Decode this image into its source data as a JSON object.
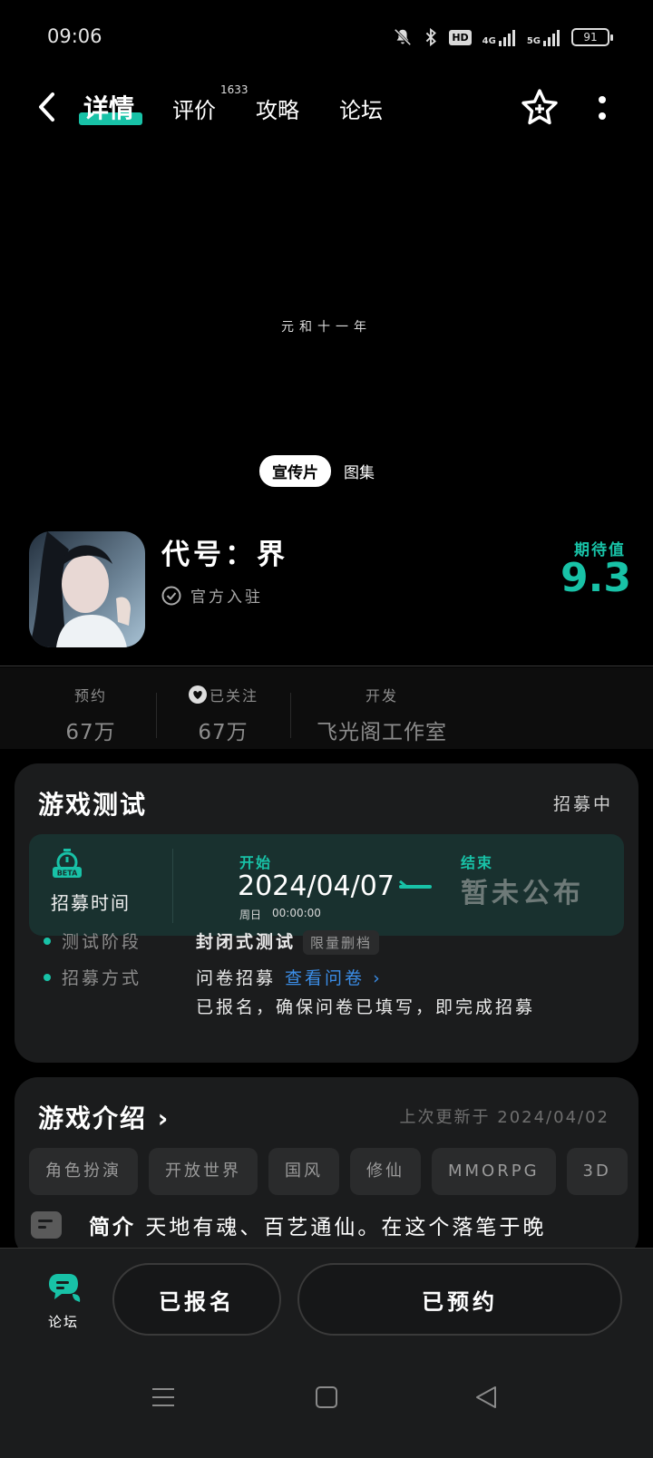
{
  "status_bar": {
    "time": "09:06",
    "network": "4G",
    "network2": "5G",
    "hd": "HD",
    "battery": "91"
  },
  "nav": {
    "tabs": [
      "详情",
      "评价",
      "攻略",
      "论坛"
    ],
    "review_count": "1633",
    "accent_color": "#18c2a7"
  },
  "video": {
    "caption": "元和十一年",
    "media_tabs": [
      "宣传片",
      "图集"
    ]
  },
  "game": {
    "title": "代号：界",
    "official": "官方入驻",
    "expect_label": "期待值",
    "expect_value": "9.3"
  },
  "stats": {
    "reserve_label": "预约",
    "reserve_value": "67万",
    "follow_label": "已关注",
    "follow_value": "67万",
    "dev_label": "开发",
    "dev_value": "飞光阁工作室"
  },
  "test": {
    "title": "游戏测试",
    "status": "招募中",
    "recruit_label": "招募时间",
    "badge": "BETA",
    "start_label": "开始",
    "start_date": "2024/04/07",
    "start_weekday": "周日",
    "start_time": "00:00:00",
    "end_label": "结束",
    "end_value": "暂未公布",
    "stage_label": "测试阶段",
    "stage_value": "封闭式测试",
    "stage_tag": "限量删档",
    "method_label": "招募方式",
    "method_value": "问卷招募",
    "method_link": "查看问卷",
    "method_note": "已报名，确保问卷已填写，即完成招募"
  },
  "intro": {
    "title": "游戏介绍",
    "updated": "上次更新于 2024/04/02",
    "tags": [
      "角色扮演",
      "开放世界",
      "国风",
      "修仙",
      "MMORPG",
      "3D"
    ],
    "summary_label": "简介",
    "summary_text": "天地有魂、百艺通仙。在这个落笔于晚"
  },
  "bottom": {
    "forum_label": "论坛",
    "signup_label": "已报名",
    "reserve_label": "已预约"
  }
}
